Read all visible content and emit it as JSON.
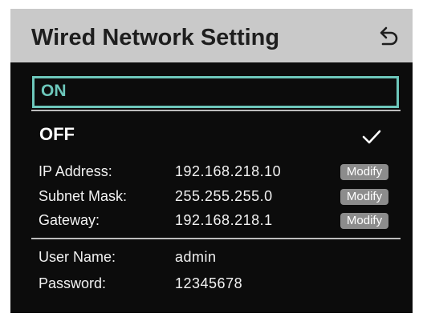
{
  "header": {
    "title": "Wired Network Setting",
    "back_icon": "return-arrow-icon"
  },
  "options": {
    "on_label": "ON",
    "off_label": "OFF",
    "selected": "OFF"
  },
  "network": {
    "ip_label": "IP Address:",
    "ip_value": "192.168.218.10",
    "subnet_label": "Subnet Mask:",
    "subnet_value": "255.255.255.0",
    "gateway_label": "Gateway:",
    "gateway_value": "192.168.218.1",
    "modify_label": "Modify"
  },
  "account": {
    "user_label": "User Name:",
    "user_value": "admin",
    "password_label": "Password:",
    "password_value": "12345678"
  },
  "colors": {
    "header_bg": "#c9c9c9",
    "screen_bg": "#0c0c0c",
    "accent": "#6dc7bb",
    "button_bg": "#8c8c8c"
  }
}
